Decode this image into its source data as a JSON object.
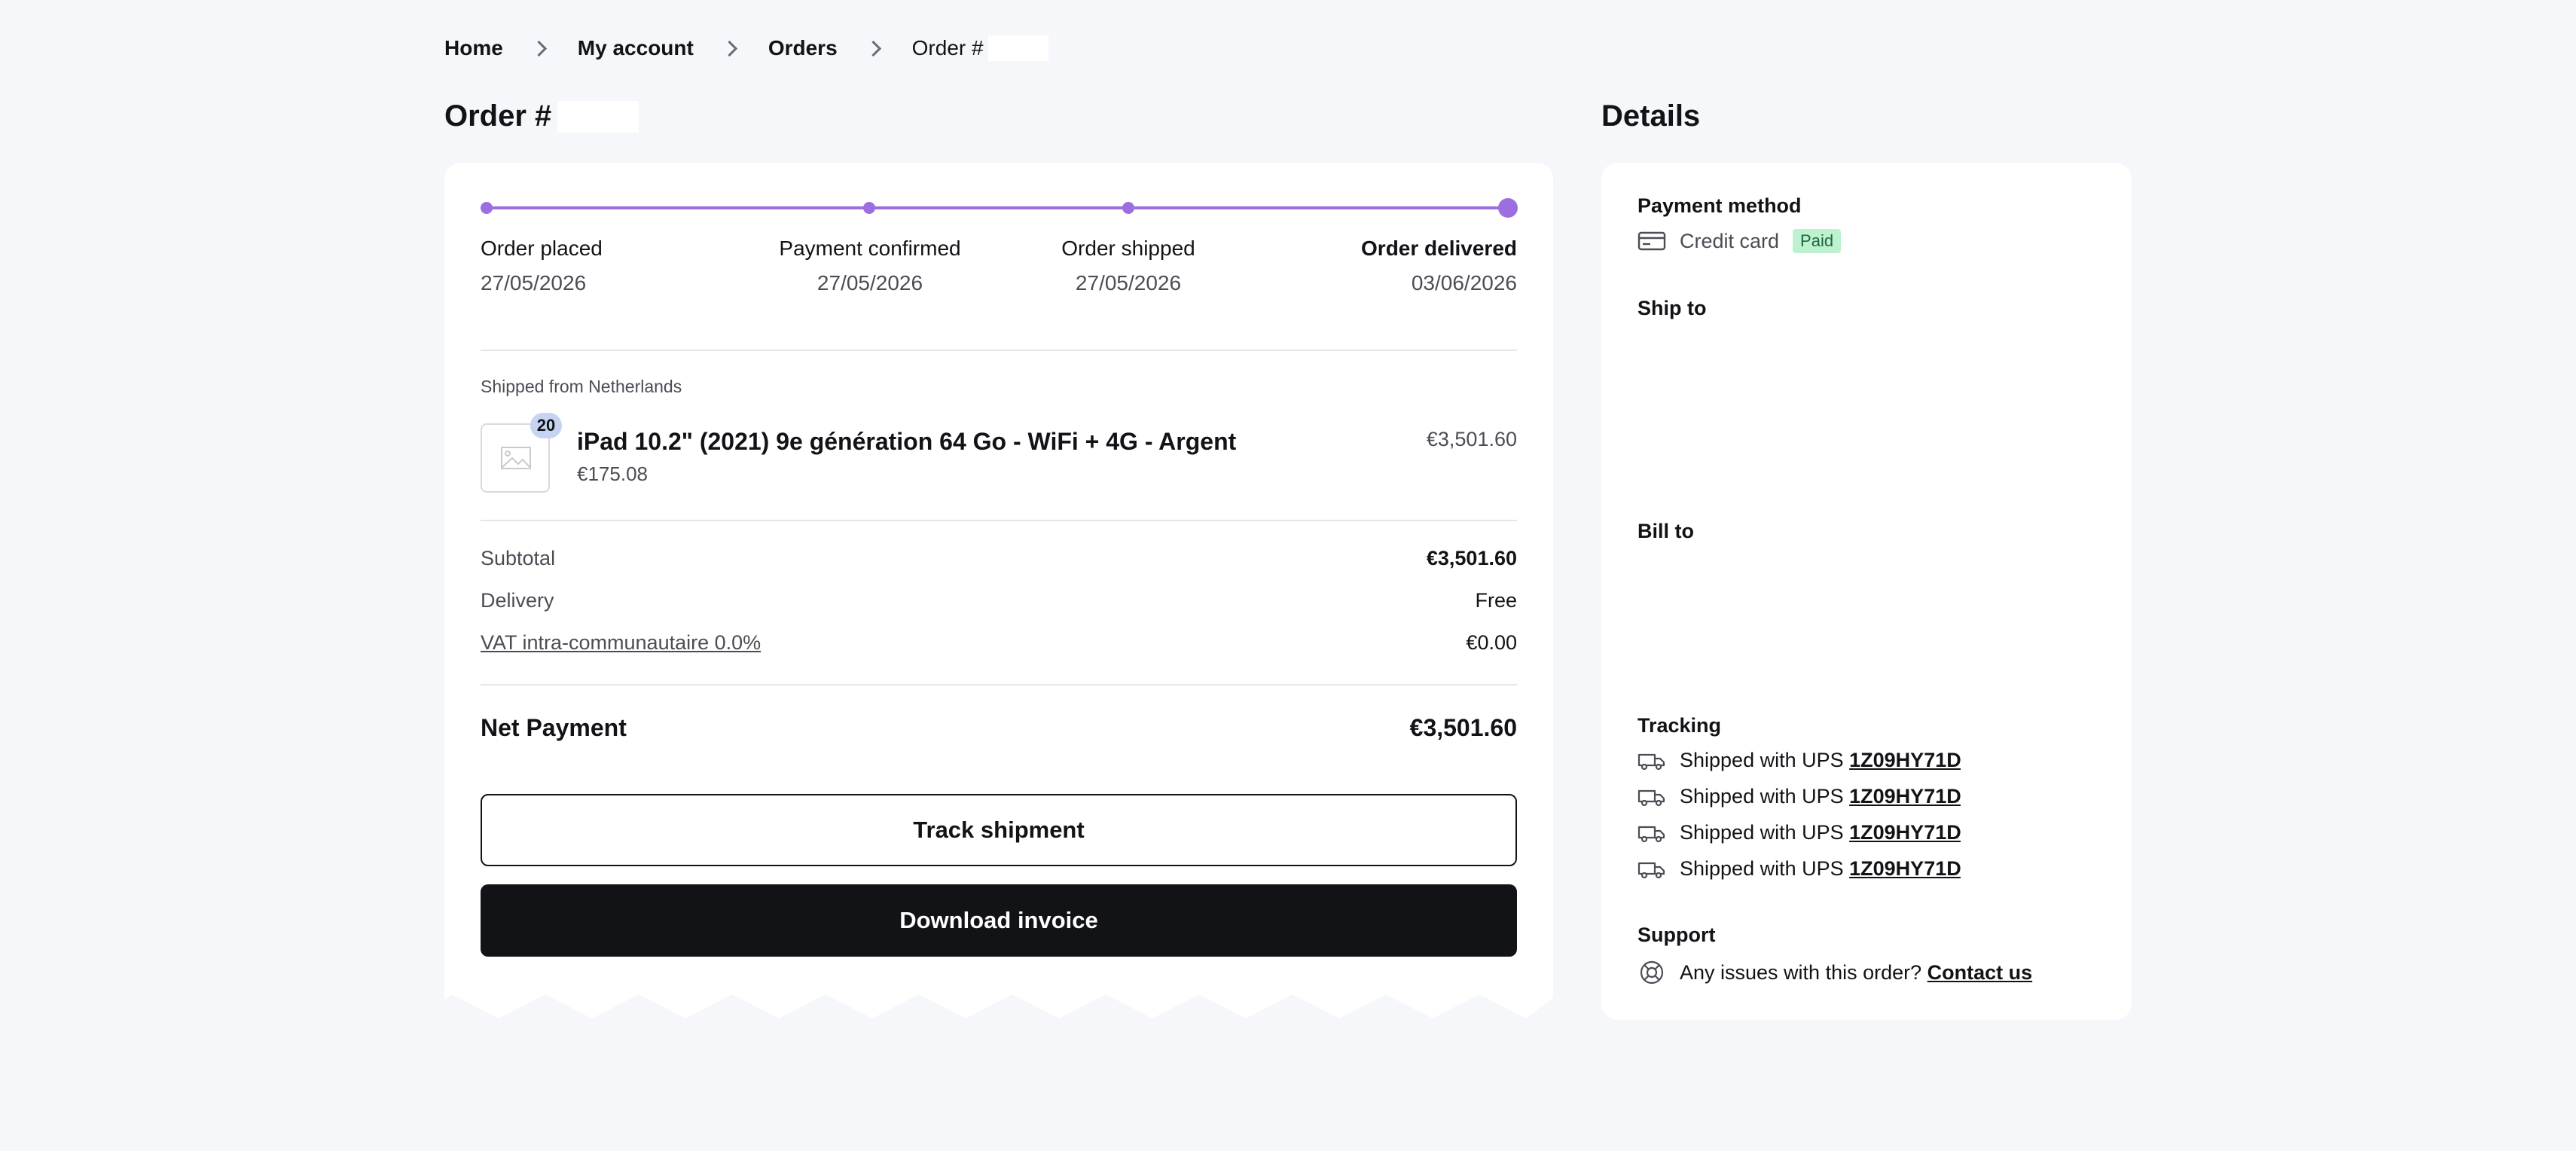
{
  "breadcrumb": {
    "items": [
      "Home",
      "My account",
      "Orders"
    ],
    "current": "Order #"
  },
  "page": {
    "order_title": "Order #",
    "details_title": "Details"
  },
  "progress": {
    "steps": [
      {
        "label": "Order placed",
        "date": "27/05/2026"
      },
      {
        "label": "Payment confirmed",
        "date": "27/05/2026"
      },
      {
        "label": "Order shipped",
        "date": "27/05/2026"
      },
      {
        "label": "Order delivered",
        "date": "03/06/2026"
      }
    ]
  },
  "shipment": {
    "origin": "Shipped from Netherlands",
    "product": {
      "name": "iPad 10.2\" (2021) 9e génération 64 Go - WiFi + 4G - Argent",
      "unit_price": "€175.08",
      "quantity": "20",
      "total": "€3,501.60",
      "image_icon": "image-placeholder-icon"
    }
  },
  "summary": {
    "subtotal_label": "Subtotal",
    "subtotal_value": "€3,501.60",
    "delivery_label": "Delivery",
    "delivery_value": "Free",
    "vat_label": "VAT intra-communautaire 0.0%",
    "vat_value": "€0.00",
    "net_label": "Net Payment",
    "net_value": "€3,501.60"
  },
  "actions": {
    "track": "Track shipment",
    "download": "Download invoice"
  },
  "details": {
    "payment_heading": "Payment method",
    "payment_method": "Credit card",
    "payment_icon": "credit-card-icon",
    "payment_status": "Paid",
    "ship_to_heading": "Ship to",
    "bill_to_heading": "Bill to",
    "tracking_heading": "Tracking",
    "tracking": [
      {
        "text": "Shipped with UPS",
        "number": "1Z09HY71D'"
      },
      {
        "text": "Shipped with UPS",
        "number": "1Z09HY71D'"
      },
      {
        "text": "Shipped with UPS",
        "number": "1Z09HY71D'"
      },
      {
        "text": "Shipped with UPS",
        "number": "1Z09HY71D"
      }
    ],
    "tracking_icon": "truck-icon",
    "support_heading": "Support",
    "support_text": "Any issues with this order?",
    "support_link": "Contact us",
    "support_icon": "lifebuoy-icon"
  },
  "colors": {
    "accent": "#9b6fe0",
    "background": "#f6f7fb",
    "dark": "#121317",
    "paid_bg": "#bdf1cf"
  }
}
